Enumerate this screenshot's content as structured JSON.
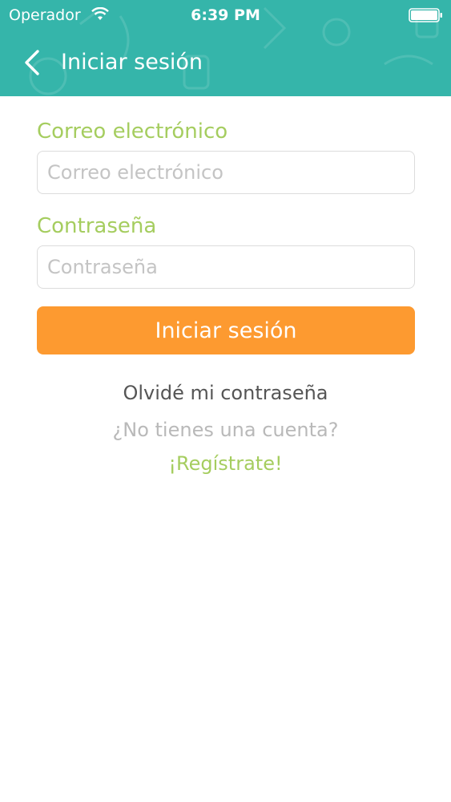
{
  "status_bar": {
    "carrier": "Operador",
    "time": "6:39 PM",
    "wifi_icon": "wifi-icon",
    "battery_icon": "battery-icon"
  },
  "nav": {
    "back_icon": "chevron-left-icon",
    "title": "Iniciar sesión"
  },
  "form": {
    "email_label": "Correo electrónico",
    "email_placeholder": "Correo electrónico",
    "email_value": "",
    "password_label": "Contraseña",
    "password_placeholder": "Contraseña",
    "password_value": "",
    "submit_label": "Iniciar sesión"
  },
  "links": {
    "forgot_password": "Olvidé mi contraseña",
    "no_account": "¿No tienes una cuenta?",
    "register": "¡Regístrate!"
  },
  "colors": {
    "header": "#35b5aa",
    "accent_green": "#a5cd5f",
    "button_orange": "#fd9a30"
  }
}
